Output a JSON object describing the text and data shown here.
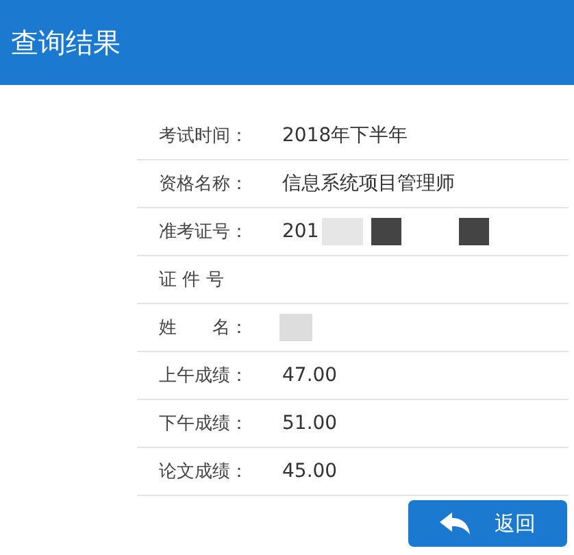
{
  "header": {
    "title": "查询结果"
  },
  "rows": [
    {
      "kind": "plain",
      "label": "考试时间：",
      "value": "2018年下半年"
    },
    {
      "kind": "plain",
      "label": "资格名称：",
      "value": "信息系统项目管理师"
    },
    {
      "kind": "masked",
      "label": "准考证号：",
      "value": "201"
    },
    {
      "kind": "plain",
      "label": "证 件 号"
    },
    {
      "kind": "blurred",
      "label": "姓　　名："
    },
    {
      "kind": "plain",
      "label": "上午成绩：",
      "value": "47.00"
    },
    {
      "kind": "plain",
      "label": "下午成绩：",
      "value": "51.00"
    },
    {
      "kind": "plain",
      "label": "论文成绩：",
      "value": "45.00"
    }
  ],
  "back_button": {
    "label": "返回"
  }
}
